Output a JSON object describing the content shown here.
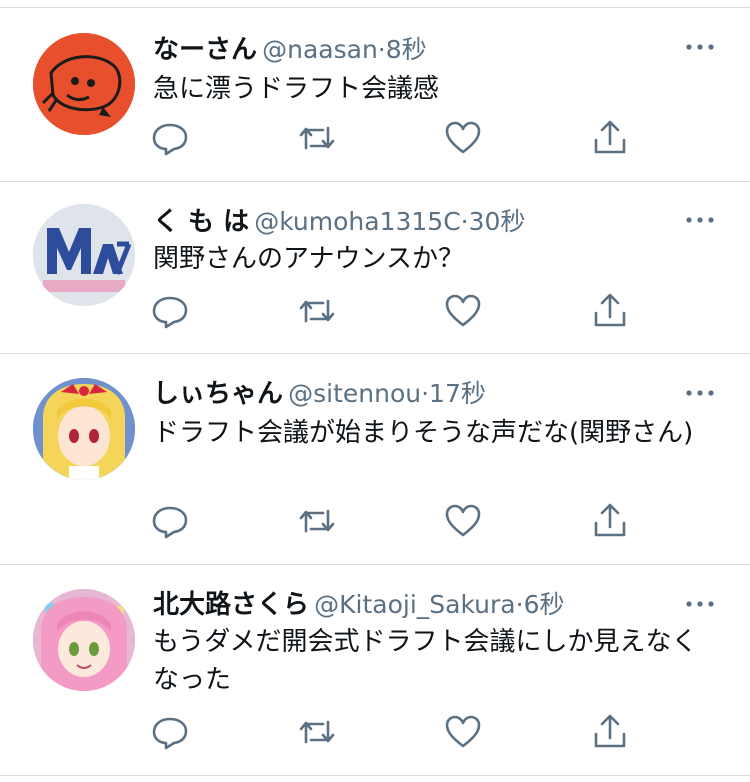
{
  "tweets": [
    {
      "name": "なーさん",
      "handle": "@naasan",
      "separator": "·",
      "time": "8秒",
      "text": "急に漂うドラフト会議感",
      "avatar_icon": "cartoon-bird-avatar",
      "colors": {
        "avatar_bg": "#e8502d"
      }
    },
    {
      "name": "く も は",
      "handle": "@kumoha1315C",
      "separator": "·",
      "time": "30秒",
      "text": "関野さんのアナウンスか？",
      "avatar_icon": "max-logo-avatar",
      "colors": {
        "avatar_bg": "#e9ecf1"
      }
    },
    {
      "name": "しぃちゃん",
      "handle": "@sitennou",
      "separator": "·",
      "time": "17秒",
      "text": "ドラフト会議が始まりそうな声だな(関野さん)",
      "avatar_icon": "anime-girl-blonde-avatar",
      "colors": {
        "avatar_bg": "#5a7fbf"
      }
    },
    {
      "name": "北大路さくら",
      "handle": "@Kitaoji_Sakura",
      "separator": "·",
      "time": "6秒",
      "text": "もうダメだ開会式ドラフト会議にしか見えなくなった",
      "avatar_icon": "anime-girl-pink-avatar",
      "colors": {
        "avatar_bg": "#f3c9dc"
      }
    }
  ],
  "action_icons": [
    "reply-icon",
    "retweet-icon",
    "like-icon",
    "share-icon"
  ],
  "colors": {
    "text": "#0f1419",
    "secondary": "#5b7083",
    "divider": "#d9d9de"
  }
}
